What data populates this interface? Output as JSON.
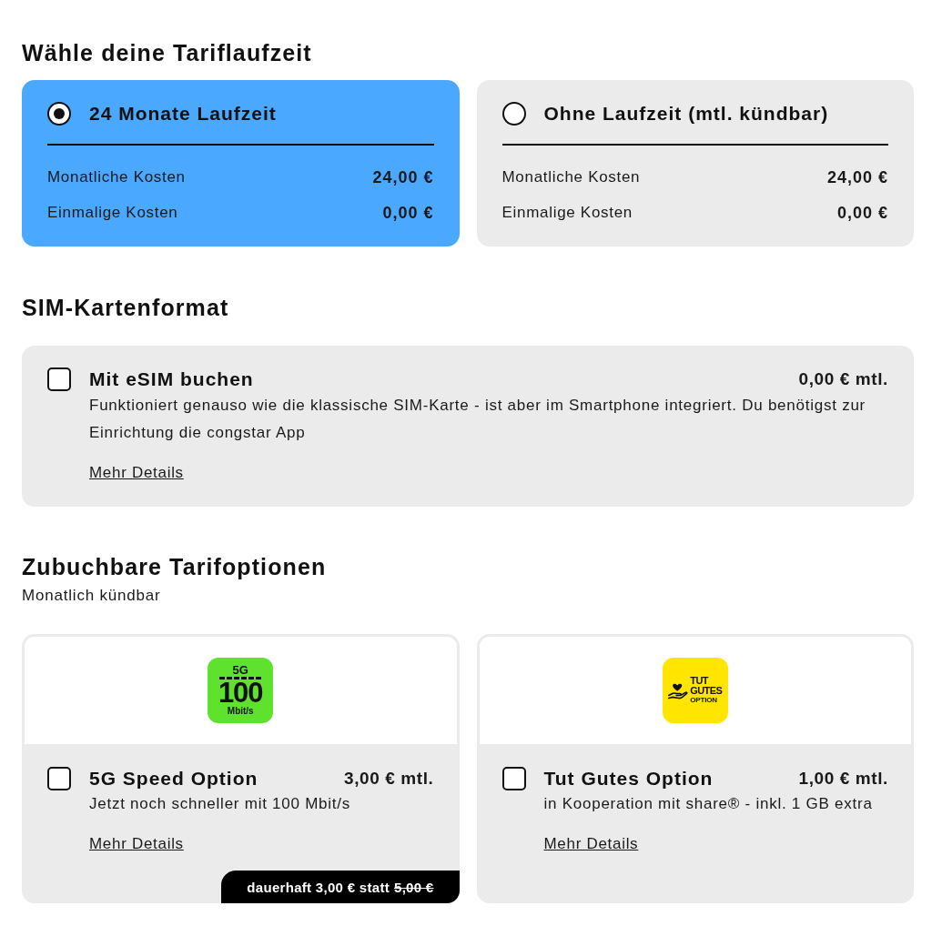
{
  "tariff_term": {
    "heading": "Wähle deine Tariflaufzeit",
    "plans": [
      {
        "label": "24 Monate Laufzeit",
        "selected": true,
        "costs": [
          {
            "label": "Monatliche Kosten",
            "value": "24,00 €"
          },
          {
            "label": "Einmalige Kosten",
            "value": "0,00 €"
          }
        ]
      },
      {
        "label": "Ohne Laufzeit (mtl. kündbar)",
        "selected": false,
        "costs": [
          {
            "label": "Monatliche Kosten",
            "value": "24,00 €"
          },
          {
            "label": "Einmalige Kosten",
            "value": "0,00 €"
          }
        ]
      }
    ]
  },
  "sim_format": {
    "heading": "SIM-Kartenformat",
    "option": {
      "label": "Mit eSIM buchen",
      "checked": false,
      "price": "0,00 € mtl.",
      "description": "Funktioniert genauso wie die klassische SIM-Karte - ist aber im Smartphone integriert. Du benötigst zur Einrichtung die congstar App",
      "link": "Mehr Details"
    }
  },
  "tariff_addons": {
    "heading": "Zubuchbare Tarifoptionen",
    "subheading": "Monatlich kündbar",
    "options": [
      {
        "logo": {
          "kind": "speed",
          "lines": [
            "5G",
            "100",
            "Mbit/s"
          ]
        },
        "label": "5G Speed Option",
        "checked": false,
        "price": "3,00 € mtl.",
        "description": "Jetzt noch schneller mit 100 Mbit/s",
        "link": "Mehr Details",
        "promo": {
          "text": "dauerhaft 3,00 € statt",
          "old_price": "5,00 €"
        }
      },
      {
        "logo": {
          "kind": "charity",
          "lines": [
            "TUT",
            "GUTES",
            "OPTION"
          ]
        },
        "label": "Tut Gutes Option",
        "checked": false,
        "price": "1,00 € mtl.",
        "description": "in Kooperation mit share® - inkl. 1 GB extra",
        "link": "Mehr Details"
      }
    ]
  }
}
